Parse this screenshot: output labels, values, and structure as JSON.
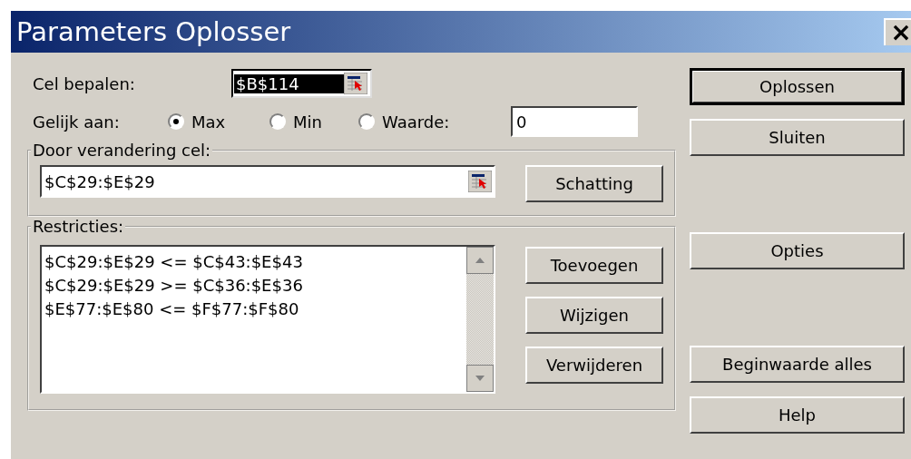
{
  "window": {
    "title": "Parameters Oplosser",
    "close": "×"
  },
  "target": {
    "label": "Cel bepalen:",
    "value": "$B$114",
    "highlighted": true
  },
  "equal_to": {
    "label": "Gelijk aan:",
    "options": [
      {
        "label": "Max",
        "selected": true
      },
      {
        "label": "Min",
        "selected": false
      },
      {
        "label": "Waarde:",
        "selected": false
      }
    ],
    "value": "0"
  },
  "changing_cells": {
    "title": "Door verandering cel:",
    "value": "$C$29:$E$29",
    "button": "Schatting"
  },
  "constraints": {
    "title": "Restricties:",
    "items": [
      "$C$29:$E$29 <= $C$43:$E$43",
      "$C$29:$E$29 >= $C$36:$E$36",
      "$E$77:$E$80 <= $F$77:$F$80"
    ],
    "buttons": [
      "Toevoegen",
      "Wijzigen",
      "Verwijderen"
    ]
  },
  "buttons": [
    {
      "label": "Oplossen",
      "default": true
    },
    {
      "label": "Sluiten",
      "default": false
    },
    {
      "label": "Opties",
      "default": false
    },
    {
      "label": "Beginwaarde alles",
      "default": false
    },
    {
      "label": "Help",
      "default": false
    }
  ]
}
